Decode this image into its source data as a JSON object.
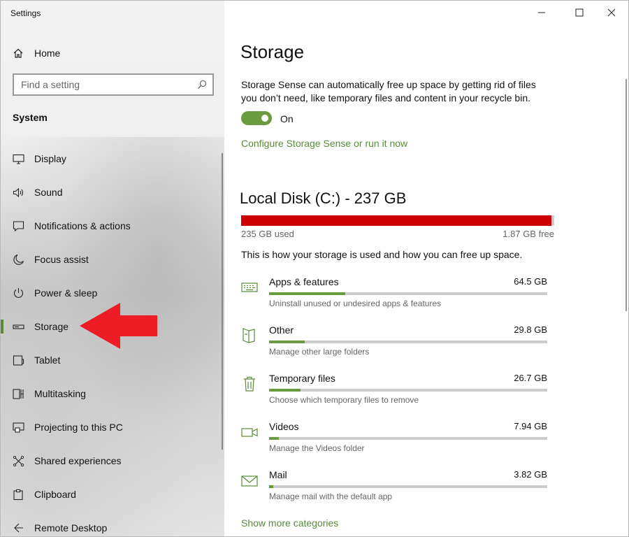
{
  "window": {
    "title": "Settings"
  },
  "sidebar": {
    "home_label": "Home",
    "search_placeholder": "Find a setting",
    "section_label": "System",
    "items": [
      {
        "label": "Display",
        "icon": "monitor-icon"
      },
      {
        "label": "Sound",
        "icon": "speaker-icon"
      },
      {
        "label": "Notifications & actions",
        "icon": "notification-icon"
      },
      {
        "label": "Focus assist",
        "icon": "moon-icon"
      },
      {
        "label": "Power & sleep",
        "icon": "power-icon"
      },
      {
        "label": "Storage",
        "icon": "storage-drive-icon",
        "selected": true
      },
      {
        "label": "Tablet",
        "icon": "tablet-icon"
      },
      {
        "label": "Multitasking",
        "icon": "multitasking-icon"
      },
      {
        "label": "Projecting to this PC",
        "icon": "projecting-icon"
      },
      {
        "label": "Shared experiences",
        "icon": "shared-experiences-icon"
      },
      {
        "label": "Clipboard",
        "icon": "clipboard-icon"
      },
      {
        "label": "Remote Desktop",
        "icon": "remote-desktop-icon"
      }
    ]
  },
  "main": {
    "title": "Storage",
    "storage_sense_description": "Storage Sense can automatically free up space by getting rid of files you don’t need, like temporary files and content in your recycle bin.",
    "toggle_state_label": "On",
    "configure_link": "Configure Storage Sense or run it now",
    "disk": {
      "title": "Local Disk (C:) - 237 GB",
      "used_label": "235 GB used",
      "free_label": "1.87 GB free",
      "used_fraction": 0.992
    },
    "usage_note": "This is how your storage is used and how you can free up space.",
    "categories": [
      {
        "name": "Apps & features",
        "size": "64.5 GB",
        "desc": "Uninstall unused or undesired apps & features",
        "fraction": 0.275,
        "icon": "keyboard-apps-icon"
      },
      {
        "name": "Other",
        "size": "29.8 GB",
        "desc": "Manage other large folders",
        "fraction": 0.127,
        "icon": "other-folder-icon"
      },
      {
        "name": "Temporary files",
        "size": "26.7 GB",
        "desc": "Choose which temporary files to remove",
        "fraction": 0.114,
        "icon": "trash-icon"
      },
      {
        "name": "Videos",
        "size": "7.94 GB",
        "desc": "Manage the Videos folder",
        "fraction": 0.034,
        "icon": "video-camera-icon"
      },
      {
        "name": "Mail",
        "size": "3.82 GB",
        "desc": "Manage mail with the default app",
        "fraction": 0.016,
        "icon": "mail-icon"
      }
    ],
    "more_link": "Show more categories"
  },
  "colors": {
    "accent": "#6b9b3f",
    "link": "#5a8a3a",
    "disk_full": "#cc0000",
    "annotation_arrow": "#ee1c25"
  }
}
